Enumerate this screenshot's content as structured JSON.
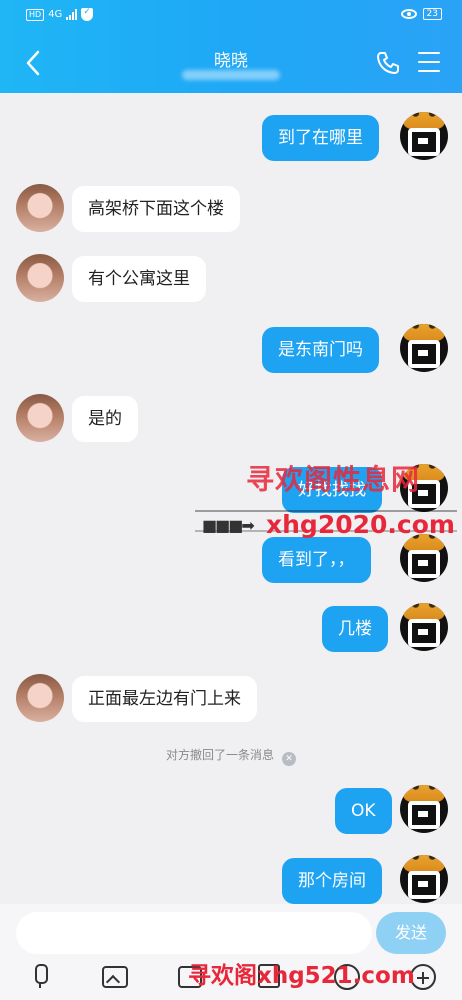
{
  "header": {
    "title": "晓晓",
    "status_left": [
      "HD",
      "4G"
    ],
    "battery": "23",
    "accent": "#1fb3f5"
  },
  "messages": [
    {
      "side": "out",
      "text": "到了在哪里"
    },
    {
      "side": "in",
      "text": "高架桥下面这个楼"
    },
    {
      "side": "in",
      "text": "有个公寓这里"
    },
    {
      "side": "out",
      "text": "是东南门吗"
    },
    {
      "side": "in",
      "text": "是的"
    },
    {
      "side": "out",
      "text": "好找找找"
    },
    {
      "side": "out",
      "text": "看到了，，"
    },
    {
      "side": "out",
      "text": "几楼"
    },
    {
      "side": "in",
      "text": "正面最左边有门上来"
    },
    {
      "side": "out",
      "text": "OK"
    },
    {
      "side": "out",
      "text": "那个房间"
    }
  ],
  "system_note": "对方撤回了一条消息",
  "input": {
    "placeholder": "",
    "send_label": "发送"
  },
  "toolbar_icons": [
    "mic-icon",
    "image-icon",
    "camera-icon",
    "file-icon",
    "emoji-icon",
    "plus-icon"
  ],
  "watermarks": {
    "top": "寻欢阁性息网",
    "middle": "xhg2020.com",
    "bottom": "寻欢阁xhg521.com"
  }
}
